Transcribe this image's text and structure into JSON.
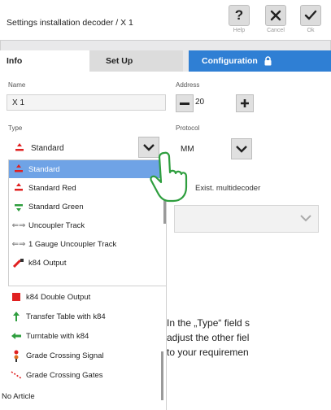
{
  "window": {
    "title": "Settings installation decoder / X 1",
    "help_label": "Help",
    "cancel_label": "Cancel",
    "ok_label": "Ok"
  },
  "tabs": [
    {
      "label": "Info"
    },
    {
      "label": "Set Up"
    },
    {
      "label": "Configuration"
    }
  ],
  "form": {
    "name_label": "Name",
    "name_value": "X 1",
    "address_label": "Address",
    "address_value": "20",
    "type_label": "Type",
    "type_value": "Standard",
    "protocol_label": "Protocol",
    "protocol_value": "MM",
    "multidecoder_label": "Exist. multidecoder",
    "multidecoder_value": ""
  },
  "type_options": [
    {
      "label": "Standard",
      "icon": "standard-signal-icon",
      "selected": true
    },
    {
      "label": "Standard Red",
      "icon": "standard-red-icon"
    },
    {
      "label": "Standard Green",
      "icon": "standard-green-icon"
    },
    {
      "label": "Uncoupler Track",
      "icon": "uncoupler-icon"
    },
    {
      "label": "1 Gauge Uncoupler Track",
      "icon": "uncoupler-icon"
    },
    {
      "label": "k84 Output",
      "icon": "k84-output-icon"
    },
    {
      "label": "k84 Double Output",
      "icon": "k84-double-output-icon"
    },
    {
      "label": "Transfer Table with k84",
      "icon": "transfer-table-icon"
    },
    {
      "label": "Turntable with k84",
      "icon": "turntable-icon"
    },
    {
      "label": "Grade Crossing Signal",
      "icon": "grade-crossing-signal-icon"
    },
    {
      "label": "Grade Crossing Gates",
      "icon": "grade-crossing-gates-icon"
    },
    {
      "label": "No Article",
      "icon": ""
    }
  ],
  "description": {
    "line1": "In the „Type“ field s",
    "line2": "adjust the other fiel",
    "line3": "to your requiremen"
  },
  "colors": {
    "accent": "#2f7fd4",
    "selection": "#6fa3e6",
    "red": "#e02020",
    "green": "#2e9e3e"
  }
}
